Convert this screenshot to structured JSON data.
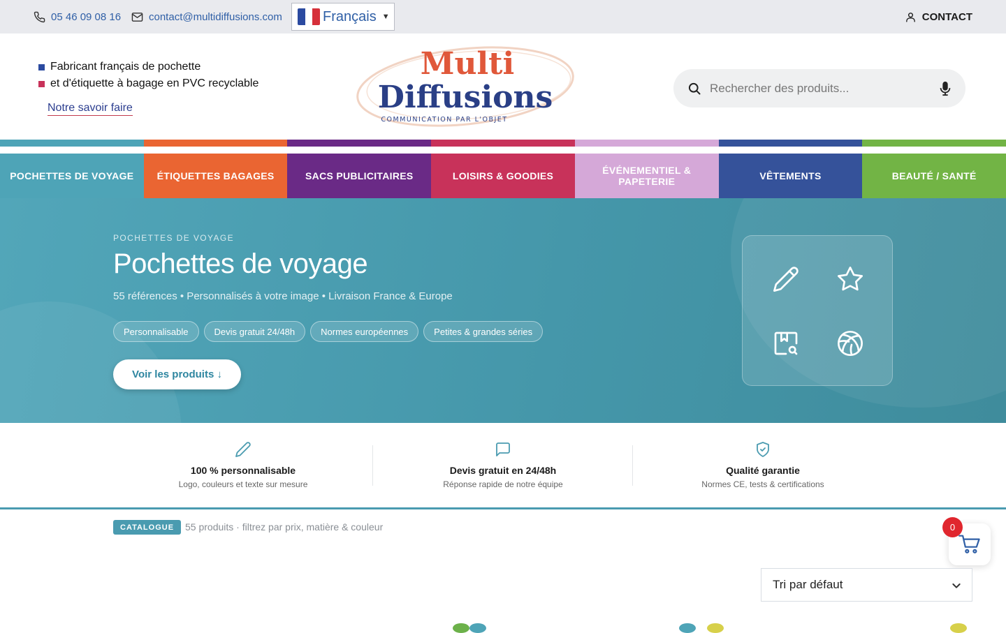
{
  "topbar": {
    "phone": "05 46 09 08 16",
    "email": "contact@multidiffusions.com",
    "language": "Français",
    "contact_label": "CONTACT"
  },
  "header": {
    "tagline_1": "Fabricant français de pochette",
    "tagline_2": "et d'étiquette à bagage en PVC recyclable",
    "savoir_faire_link": "Notre savoir faire",
    "logo_line_1": "Multi",
    "logo_line_2": "Diffusions",
    "logo_sub": "COMMUNICATION PAR L'OBJET",
    "search_placeholder": "Rechercher des produits..."
  },
  "nav": {
    "items": [
      {
        "label": "POCHETTES DE VOYAGE",
        "color": "#4ea4b7"
      },
      {
        "label": "ÉTIQUETTES BAGAGES",
        "color": "#ea6532"
      },
      {
        "label": "SACS PUBLICITAIRES",
        "color": "#6a2a86"
      },
      {
        "label": "LOISIRS & GOODIES",
        "color": "#c8325a"
      },
      {
        "label": "ÉVÉNEMENTIEL & PAPETERIE",
        "color": "#d5a8d8"
      },
      {
        "label": "VÊTEMENTS",
        "color": "#35529a"
      },
      {
        "label": "BEAUTÉ / SANTÉ",
        "color": "#72b445"
      }
    ]
  },
  "hero": {
    "kicker": "POCHETTES DE VOYAGE",
    "title": "Pochettes de voyage",
    "meta": "55 références • Personnalisés à votre image • Livraison France & Europe",
    "chips": [
      "Personnalisable",
      "Devis gratuit 24/48h",
      "Normes européennes",
      "Petites & grandes séries"
    ],
    "cta": "Voir les produits ↓",
    "card_icons": [
      "pencil-icon",
      "star-icon",
      "search-document-icon",
      "basketball-icon"
    ]
  },
  "features": [
    {
      "icon": "pencil-icon",
      "title": "100 % personnalisable",
      "subtitle": "Logo, couleurs et texte sur mesure"
    },
    {
      "icon": "chat-bubble-icon",
      "title": "Devis gratuit en 24/48h",
      "subtitle": "Réponse rapide de notre équipe"
    },
    {
      "icon": "shield-check-icon",
      "title": "Qualité garantie",
      "subtitle": "Normes CE, tests & certifications"
    }
  ],
  "catalogue": {
    "badge": "CATALOGUE",
    "summary": "55 produits · filtrez par prix, matière & couleur",
    "sort_value": "Tri par défaut"
  },
  "cart": {
    "count": "0"
  },
  "colors": {
    "accent": "#4a9bb0",
    "link_blue": "#2f5fa6",
    "cart_badge": "#e0262e"
  }
}
